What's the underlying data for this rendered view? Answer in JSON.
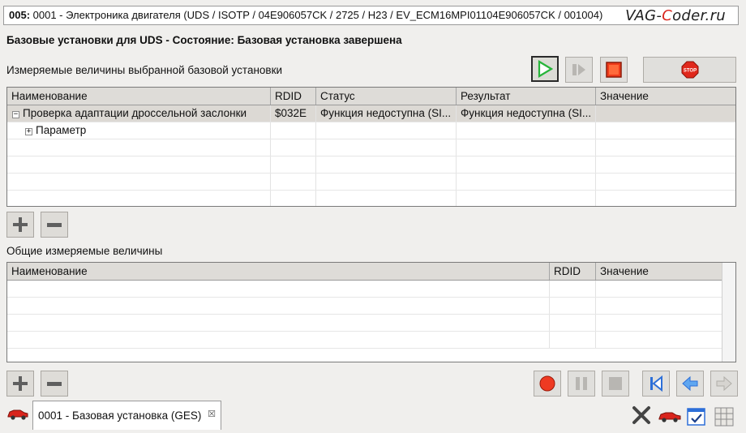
{
  "window": {
    "title_code": "005:",
    "title_rest": " 0001 - Электроника двигателя  (UDS / ISOTP / 04E906057CK / 2725 / H23 / EV_ECM16MPI01104E906057CK / 001004)",
    "watermark_a": "VAG-",
    "watermark_c": "C",
    "watermark_b": "oder.ru"
  },
  "heading": "Базовые установки для UDS - Состояние: Базовая установка завершена",
  "section1": {
    "label": "Измеряемые величины выбранной базовой установки",
    "columns": [
      "Наименование",
      "RDID",
      "Статус",
      "Результат",
      "Значение"
    ],
    "rows": [
      {
        "sign": "−",
        "name": "Проверка адаптации дроссельной заслонки",
        "rdid": "$032E",
        "status": "Функция недоступна (SI...",
        "result": "Функция недоступна (SI...",
        "value": ""
      },
      {
        "sign": "+",
        "name": "Параметр",
        "rdid": "",
        "status": "",
        "result": "",
        "value": ""
      }
    ]
  },
  "section2": {
    "label": "Общие измеряемые величины",
    "columns": [
      "Наименование",
      "RDID",
      "Значение"
    ]
  },
  "toolbar": {
    "stop_label": "STOP"
  },
  "tab": {
    "label": "0001 - Базовая установка (GES)",
    "close": "☒"
  },
  "colors": {
    "accent_red": "#d9241c",
    "play_green": "#27b53a",
    "nav_blue": "#2d6fd8"
  }
}
